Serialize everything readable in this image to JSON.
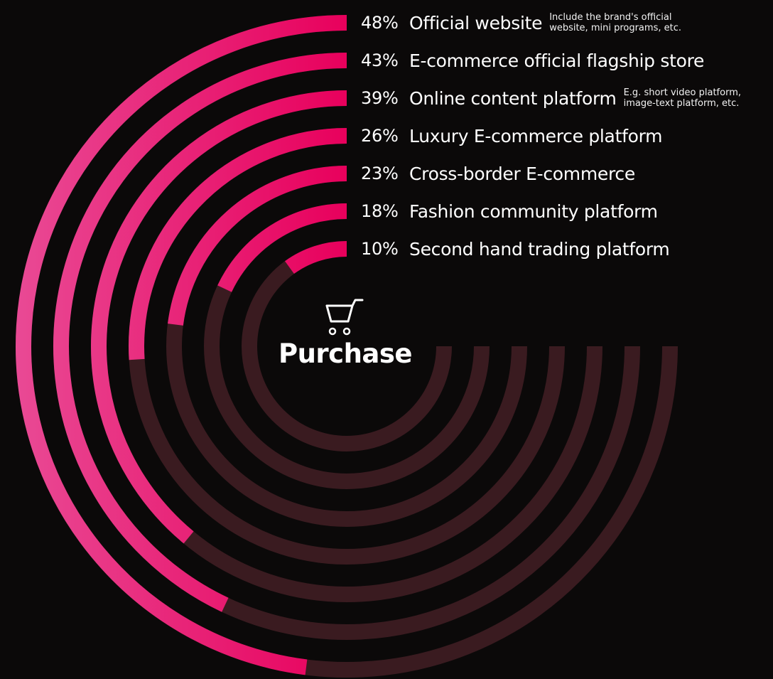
{
  "chart_data": {
    "type": "radial-bar",
    "center_label": "Purchase",
    "center_icon": "shopping-cart-icon",
    "unit": "%",
    "max_value": 100,
    "colors": {
      "filled_start": "#e8005c",
      "filled_end": "#e94a95",
      "track": "#3a1b20",
      "background": "#0b0909"
    },
    "series": [
      {
        "value": 48,
        "percent_label": "48%",
        "label": "Official website",
        "note_lines": [
          "Include the brand's official",
          "website, mini programs, etc."
        ]
      },
      {
        "value": 43,
        "percent_label": "43%",
        "label": "E-commerce official flagship store",
        "note_lines": []
      },
      {
        "value": 39,
        "percent_label": "39%",
        "label": "Online content platform",
        "note_lines": [
          "E.g. short video platform,",
          "image-text platform, etc."
        ]
      },
      {
        "value": 26,
        "percent_label": "26%",
        "label": "Luxury E-commerce platform",
        "note_lines": []
      },
      {
        "value": 23,
        "percent_label": "23%",
        "label": "Cross-border E-commerce",
        "note_lines": []
      },
      {
        "value": 18,
        "percent_label": "18%",
        "label": "Fashion community platform",
        "note_lines": []
      },
      {
        "value": 10,
        "percent_label": "10%",
        "label": "Second hand trading platform",
        "note_lines": []
      }
    ]
  }
}
